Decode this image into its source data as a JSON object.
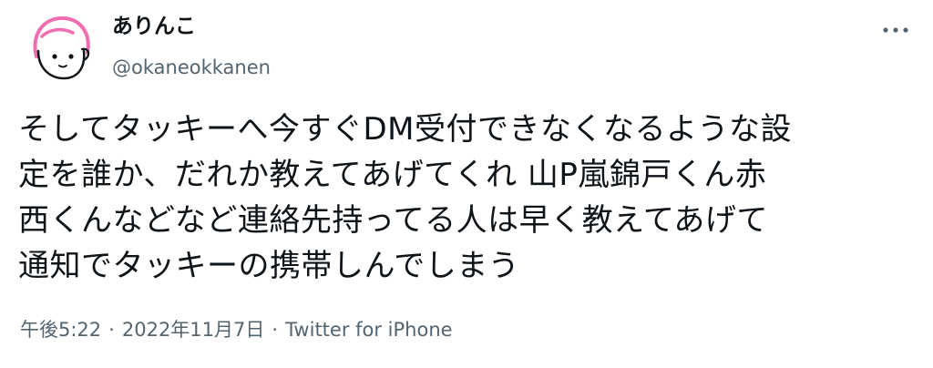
{
  "user": {
    "display_name": "ありんこ",
    "handle": "@okaneokkanen",
    "avatar_icon": "avatar-drawing-icon"
  },
  "menu": {
    "more_icon": "more-horizontal-icon"
  },
  "tweet": {
    "lines": [
      "そしてタッキーへ今すぐDM受付できなくなるような設",
      "定を誰か、だれか教えてあげてくれ 山P嵐錦戸くん赤",
      "西くんなどなど連絡先持ってる人は早く教えてあげて",
      "通知でタッキーの携帯しんでしまう"
    ]
  },
  "meta": {
    "time": "午後5:22",
    "separator": "·",
    "date": "2022年11月7日",
    "source": "Twitter for iPhone"
  },
  "colors": {
    "text": "#0f1419",
    "secondary": "#536471",
    "avatar_pink": "#f06eb0"
  }
}
